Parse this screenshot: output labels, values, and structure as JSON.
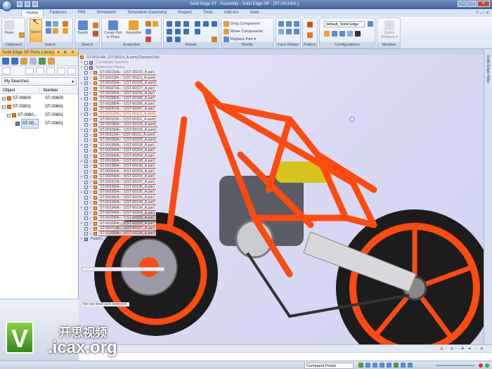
{
  "window": {
    "title": "Solid Edge ST - Assembly - Solid Edge SP - [ST-00114/A-]",
    "controls": [
      "–",
      "□",
      "✕"
    ]
  },
  "tabs": [
    "Home",
    "Features",
    "PMI",
    "Simulation",
    "Simulation Geometry",
    "Inspect",
    "Tools",
    "Add-Ins",
    "View"
  ],
  "tab_right": "? – ▫ ✕",
  "ribbon": {
    "clipboard": {
      "label": "Clipboard",
      "paste": "Paste"
    },
    "select": {
      "label": "Select",
      "select": "Select"
    },
    "sketch": {
      "label": "Sketch",
      "sketch": "Sketch"
    },
    "assemble": {
      "label": "Assemble",
      "create_part": "Create Part In-Place",
      "assemble": "Assemble"
    },
    "relate": {
      "label": "Relate"
    },
    "modify": {
      "label": "Modify",
      "items": [
        "Drag Component",
        "Move Components",
        "Replace Part ▾"
      ]
    },
    "face_relate": {
      "label": "Face Relate"
    },
    "pattern": {
      "label": "Pattern"
    },
    "configurations": {
      "label": "Configurations",
      "value": "default_Solid Edge"
    },
    "window": {
      "label": "Window",
      "switch": "Switch Windows ▾"
    }
  },
  "library": {
    "title": "Solid Edge SP Parts Library",
    "search": "My Searches",
    "columns": [
      "Object",
      "Number"
    ],
    "rows": [
      {
        "exp": "+",
        "object": "ST-00600",
        "number": "ST-00600"
      },
      {
        "exp": "−",
        "object": "ST-00601",
        "number": "ST-00601"
      },
      {
        "exp": "−",
        "object": "ST-0060...",
        "number": "ST-00601"
      },
      {
        "exp": "",
        "object": "ST-00...",
        "number": "ST-00601"
      }
    ]
  },
  "tree": {
    "root": "ST-00114/A- (ST-00114_A.asm)Checked Out",
    "items": [
      {
        "label": "Coordinate Systems",
        "kind": "grey"
      },
      {
        "label": "Reference Planes",
        "kind": "grey"
      },
      {
        "label": "ST-00210/A-- :1(ST-00210_A.par)"
      },
      {
        "label": "ST-00113/A-- :1(ST-00113_A.asm)"
      },
      {
        "label": "ST-00105/A-- :1(ST-00105_A.asm)"
      },
      {
        "label": "ST-00327/A-- :1(ST-00327_A.par)"
      },
      {
        "label": "ST-00290/A-- :1(ST-00290_A.par)"
      },
      {
        "label": "ST-00289/A-- :1(ST-00289_A.par)"
      },
      {
        "label": "ST-00288/A-- :1(ST-00288_A.par)"
      },
      {
        "label": "ST-00287/A-- :1(ST-00287_A.par)"
      },
      {
        "label": "ST-00112/A-- :1(ST-00112_A.asm)",
        "kind": "hl"
      },
      {
        "label": "ST-00110/A-- :1(ST-00110_A.asm)"
      },
      {
        "label": "ST-00108/A-- :1(ST-00108_A.asm)"
      },
      {
        "label": "ST-00109/A-- :1(ST-00109_A.asm)"
      },
      {
        "label": "ST-00111/A-- :1(ST-00111_A.asm)"
      },
      {
        "label": "ST-00209/A-- :1(ST-00209_A.asm)"
      },
      {
        "label": "ST-00199/A-- :1(ST-00199_A.par)"
      },
      {
        "label": "ST-00254/A-- :1(ST-00254_A.par)"
      },
      {
        "label": "ST-00254/A-- :2(ST-00254_A.par)"
      },
      {
        "label": "ST-00198/A-- :1(ST-00198_A.par)"
      },
      {
        "label": "ST-00198/A-- :2(ST-00198_A.par)"
      },
      {
        "label": "ST-00254/A-- :3(ST-00254_A.par)"
      },
      {
        "label": "ST-00254/A-- :4(ST-00254_A.par)"
      },
      {
        "label": "ST-00197/A-- :1(ST-00197_A.par)"
      },
      {
        "label": "ST-00196/A-- :1(ST-00196_A.par)"
      },
      {
        "label": "ST-00195/A-- :1(ST-00195_A.par)"
      },
      {
        "label": "ST-00196/A-- :2(ST-00196_A.par)"
      },
      {
        "label": "ST-00194/A-- :1(ST-00194_A.par)"
      },
      {
        "label": "ST-00194/A-- :2(ST-00194_A.par)"
      },
      {
        "label": "ST-00254/A-- :5(ST-00254_A.par)"
      },
      {
        "label": "ST-00328/A-- :1(ST-00328_A.par)"
      },
      {
        "label": "ST-00328/A-- :2(ST-00328_A.par)"
      },
      {
        "label": "ST-00327/A-- :1(ST-00327_A.par)"
      },
      {
        "label": "ST-00326/A-- :1(ST-00326_A.par)"
      }
    ],
    "pattern": "Pattern_1",
    "status": "No top level part selected."
  },
  "help_strip": "Solid Edge Help",
  "command_bar_icons": "A⁺ A⁻ ≙ ▾ ◦ ✕",
  "status": {
    "command_finder": "Command Finder"
  },
  "watermark": {
    "logo": "V",
    "cn": "开思视频",
    "en": ".icax.org"
  },
  "colors": {
    "frame": "#ff4a10",
    "tire": "#222222",
    "accent": "#f3b64a"
  }
}
